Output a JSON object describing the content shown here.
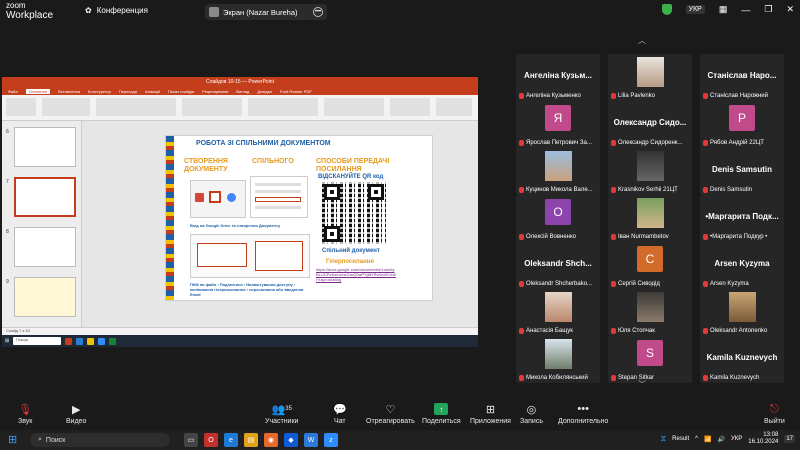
{
  "top": {
    "brand_line1": "zoom",
    "brand_line2": "Workplace",
    "conference_label": "Конференция",
    "share_label": "Экран (Nazar Bureha)"
  },
  "ppt": {
    "window_title": "Слайдов 10-15 — PowerPoint",
    "tabs": [
      "Файл",
      "Основное",
      "Вставлення",
      "Конструктор",
      "Переходи",
      "Анімації",
      "Показ слайдів",
      "Рецензування",
      "Вигляд",
      "Довідка",
      "Foxit Reader PDF"
    ],
    "status_left": "Слайд 7 з 10",
    "search_placeholder": "Пошук",
    "slide": {
      "title": "РОБОТА ЗІ СПІЛЬНИМИ ДОКУМЕНТОМ",
      "col1": "СТВОРЕННЯ",
      "col1b": "ДОКУМЕНТУ",
      "col2": "СПІЛЬНОГО",
      "col3": "СПОСОБИ ПЕРЕДАЧІ",
      "col3b": "ПОСИЛАННЯ",
      "scan": "ВІДСКАНУЙТЕ QR код",
      "google_caption": "Вхід на Google Drive та створення Документу",
      "shared_doc": "Спільний документ",
      "hyperlink": "Гіперпосилання",
      "link": "https://docs.google.com/document/d/1oen6yBLUCPeKzmUnzGmQ0wPYj8tYRvKm8Y/edit?usp=sharing",
      "pkm": "ПКМ на файл › Поділитися › Налаштування доступу › копіювання гіперпосилання › пересилання або введення Email"
    }
  },
  "gallery": {
    "tiles": [
      {
        "big": "Ангеліна  Кузьм...",
        "label": "Ангеліна Кузьменко"
      },
      {
        "avatar": "photo",
        "label": "Lilia Pavlenko"
      },
      {
        "big": "Станіслав  Наро...",
        "label": "Станіслав Нарожний"
      },
      {
        "avatar": "Я",
        "label": "Ярослав Петрович За..."
      },
      {
        "big": "Олександр  Сидо...",
        "label": "Олександр Сидоренк..."
      },
      {
        "avatar": "Р",
        "label": "Рябов Андрій 22ЦТ"
      },
      {
        "avatar": "photo",
        "label": "Куцинов Микола Вале..."
      },
      {
        "avatar": "photo",
        "label": "Krasnikov Serhii 21ЦТ"
      },
      {
        "big": "Denis  Samsutin",
        "label": "Denis Samsutin"
      },
      {
        "avatar": "О",
        "label": "Олексій Вовненко"
      },
      {
        "avatar": "photo",
        "label": "Іван Nurmambetov"
      },
      {
        "big": "•Маргарита  Подк...",
        "label": "•Маргарита Подкур •"
      },
      {
        "big": "Oleksandr  Shch...",
        "label": "Oleksandr Shcherbako..."
      },
      {
        "avatar": "С",
        "label": "Сергій Сиводід"
      },
      {
        "big": "Arsen  Kyzyma",
        "label": "Arsen Kyzyma"
      },
      {
        "avatar": "photo",
        "label": "Анастасія Бащук"
      },
      {
        "avatar": "photo",
        "label": "Юля Стопчак"
      },
      {
        "avatar": "photo",
        "label": "Oleksandr Antonenko"
      },
      {
        "avatar": "photo",
        "label": "Микола Кобилянський"
      },
      {
        "avatar": "S",
        "label": "Stepan Sitkar"
      },
      {
        "big": "Kamila  Kuznevych",
        "label": "Kamila Kuznevych"
      }
    ]
  },
  "toolbar": {
    "audio": "Звук",
    "video": "Видео",
    "participants": "Участники",
    "participants_count": "35",
    "chat": "Чат",
    "react": "Отреагировать",
    "share": "Поделиться",
    "apps": "Приложения",
    "record": "Запись",
    "more": "Дополнительно",
    "leave": "Выйти"
  },
  "taskbar": {
    "search": "Поиск",
    "result": "Result",
    "lang": "УКР",
    "time": "13:08",
    "date": "16.10.2024",
    "badge": "17"
  }
}
